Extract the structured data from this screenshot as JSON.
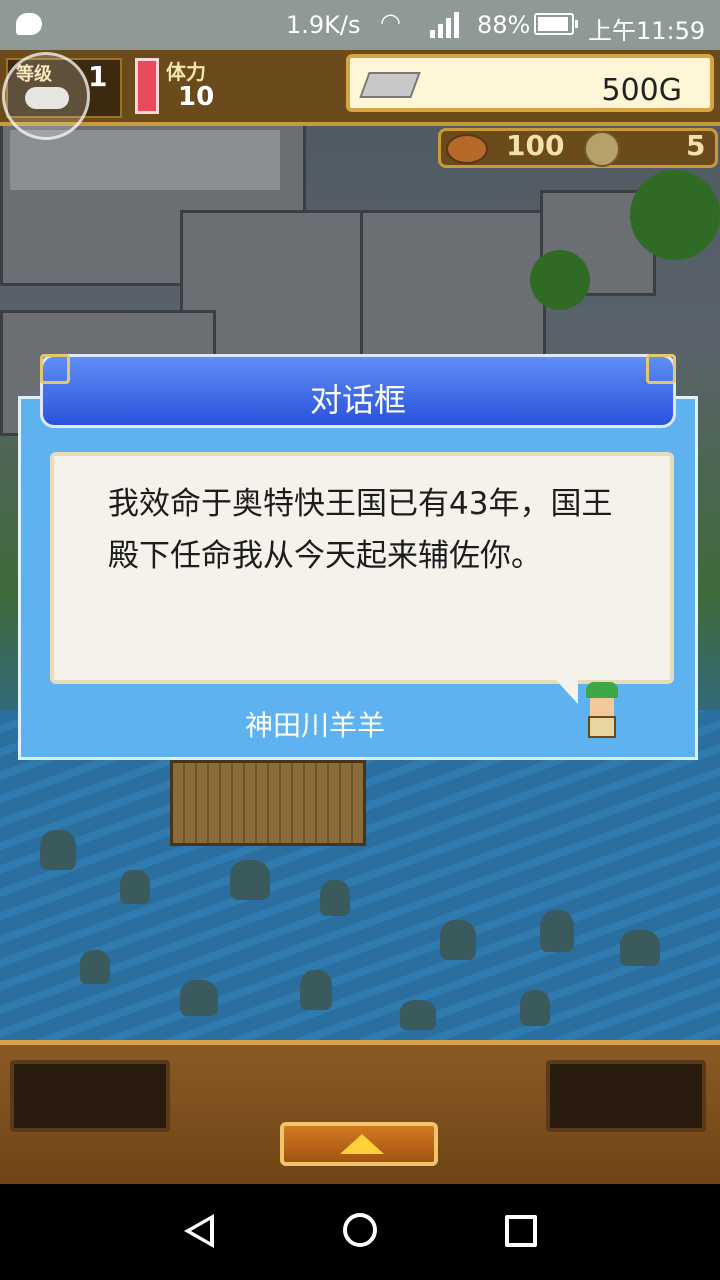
{
  "status_bar": {
    "net_speed": "1.9K/s",
    "battery": "88%",
    "time": "上午11:59",
    "icons": [
      "message-icon",
      "wifi-icon",
      "signal-icon",
      "battery-icon"
    ]
  },
  "hud": {
    "level_label": "等级",
    "level_value": "1",
    "stamina_label": "体力",
    "stamina_value": "10",
    "gold": "500G",
    "food": "100",
    "coins": "5"
  },
  "dialog": {
    "title": "对话框",
    "message": "我效命于奥特快王国已有43年，国王殿下任命我从今天起来辅佐你。",
    "speaker": "神田川羊羊"
  },
  "colors": {
    "dialog_bg": "#5fb2f0",
    "title_bar": "#2a52db",
    "hud_wood": "#6b4a1c",
    "gold_border": "#d4a542"
  },
  "nav": {
    "icons": [
      "back-icon",
      "home-icon",
      "recent-apps-icon"
    ]
  }
}
